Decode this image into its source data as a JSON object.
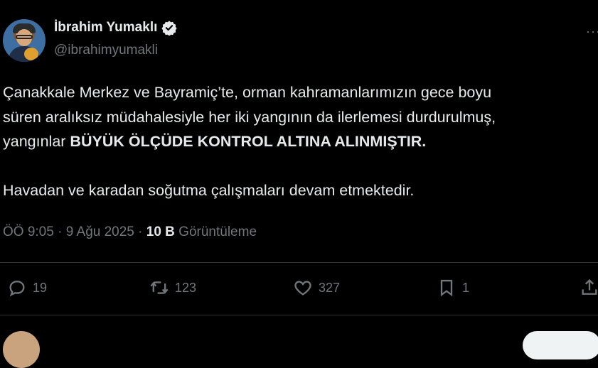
{
  "author": {
    "name": "İbrahim Yumaklı",
    "handle": "@ibrahimyumakli"
  },
  "post": {
    "line1": "Çanakkale Merkez ve Bayramiç’te, orman kahramanlarımızın gece boyu",
    "line2": "süren aralıksız müdahalesiyle her iki yangının da ilerlemesi durdurulmuş,",
    "line3_prefix": "yangınlar ",
    "line3_bold": "BÜYÜK ÖLÇÜDE KONTROL ALTINA ALINMIŞTIR.",
    "line4": "Havadan ve karadan soğutma çalışmaları devam etmektedir."
  },
  "meta": {
    "time": "ÖÖ 9:05",
    "sep1": " · ",
    "date": "9 Ağu 2025",
    "sep2": " · ",
    "views_count": "10 B",
    "views_label": " Görüntüleme"
  },
  "actions": {
    "replies": "19",
    "reposts": "123",
    "likes": "327",
    "bookmarks": "1"
  },
  "colors": {
    "background": "#000000",
    "text": "#e7e9ea",
    "muted": "#71767b",
    "verified": "#e7e9ea"
  }
}
